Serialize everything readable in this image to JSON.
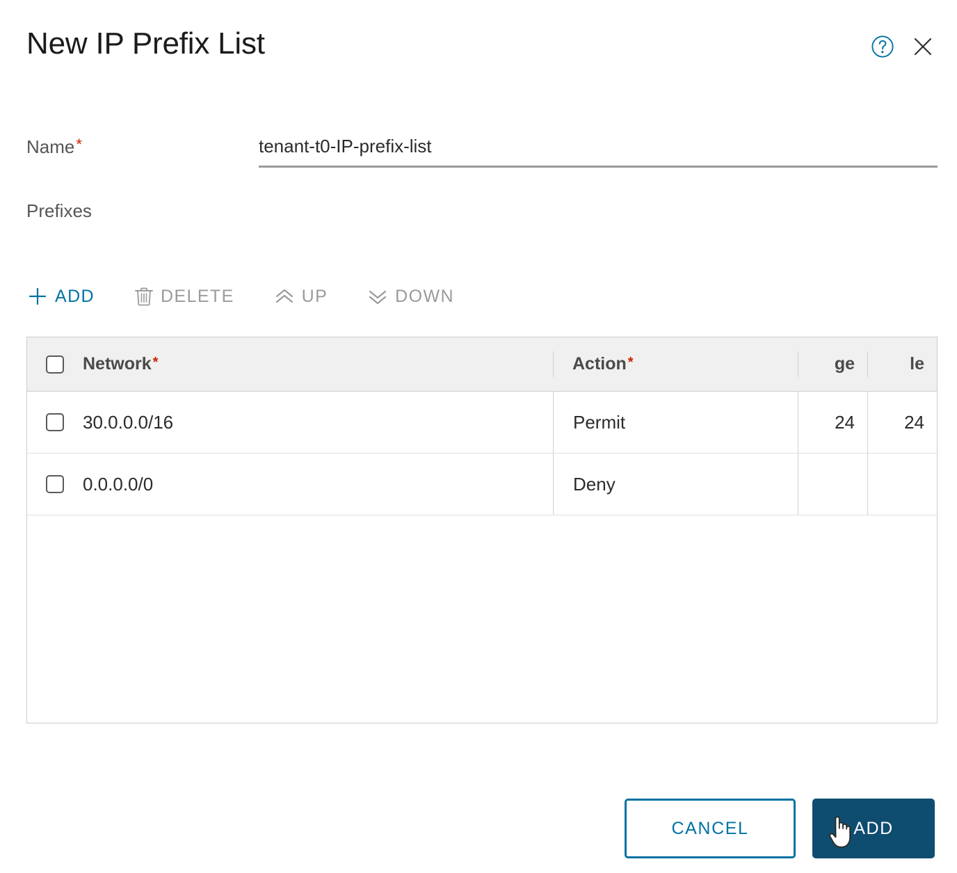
{
  "dialog": {
    "title": "New IP Prefix List",
    "help_icon": "help-circle-icon",
    "close_icon": "close-icon"
  },
  "form": {
    "name_label": "Name",
    "name_required_marker": "*",
    "name_value": "tenant-t0-IP-prefix-list",
    "name_placeholder": "",
    "section_label": "Prefixes"
  },
  "toolbar": {
    "add_label": "ADD",
    "delete_label": "DELETE",
    "up_label": "UP",
    "down_label": "DOWN",
    "add_icon": "plus-icon",
    "delete_icon": "trash-icon",
    "up_icon": "double-chevron-up-icon",
    "down_icon": "double-chevron-down-icon"
  },
  "table": {
    "columns": [
      {
        "key": "network",
        "label": "Network",
        "required": "*"
      },
      {
        "key": "action",
        "label": "Action",
        "required": "*"
      },
      {
        "key": "ge",
        "label": "ge",
        "required": ""
      },
      {
        "key": "le",
        "label": "le",
        "required": ""
      }
    ],
    "rows": [
      {
        "network": "30.0.0.0/16",
        "action": "Permit",
        "ge": "24",
        "le": "24"
      },
      {
        "network": "0.0.0.0/0",
        "action": "Deny",
        "ge": "",
        "le": ""
      }
    ]
  },
  "footer": {
    "cancel_label": "CANCEL",
    "add_label": "ADD"
  },
  "colors": {
    "accent_blue": "#0072a3",
    "primary_button": "#0f4d70",
    "required_red": "#c92100",
    "disabled_grey": "#9a9a9a",
    "header_row_bg": "#f0f0f0",
    "border_grey": "#cccccc"
  }
}
